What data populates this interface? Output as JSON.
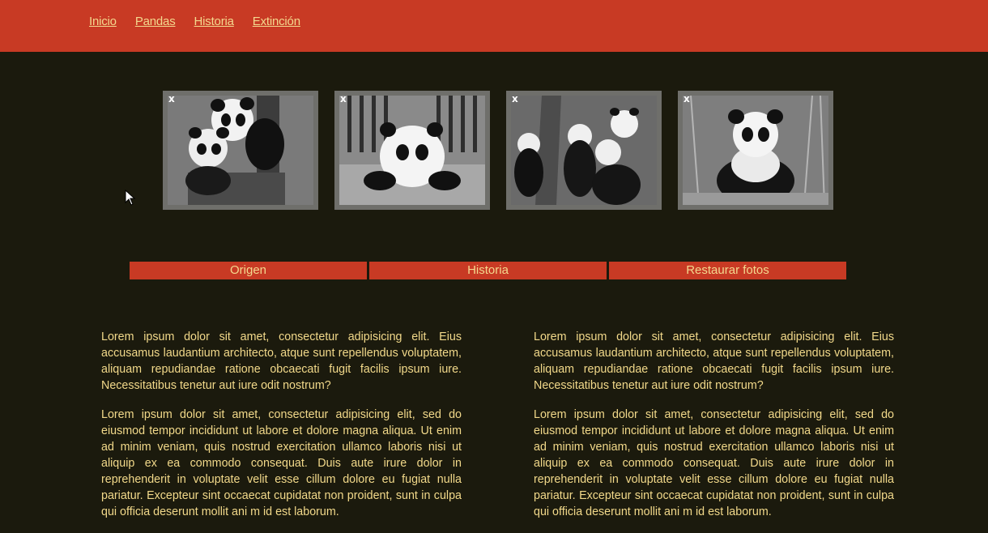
{
  "nav": {
    "items": [
      "Inicio",
      "Pandas",
      "Historia",
      "Extinción"
    ]
  },
  "gallery": {
    "close_label": "x",
    "photos": [
      {
        "icon": "panda-pair-tree-image"
      },
      {
        "icon": "panda-cub-fence-image"
      },
      {
        "icon": "panda-group-tree-image"
      },
      {
        "icon": "panda-bamboo-image"
      }
    ]
  },
  "buttons": {
    "origen": "Origen",
    "historia": "Historia",
    "restaurar": "Restaurar fotos"
  },
  "content": {
    "left": {
      "p1": "Lorem ipsum dolor sit amet, consectetur adipisicing elit. Eius accusamus laudantium architecto, atque sunt repellendus voluptatem, aliquam repudiandae ratione obcaecati fugit facilis ipsum iure. Necessitatibus tenetur aut iure odit nostrum?",
      "p2": "Lorem ipsum dolor sit amet, consectetur adipisicing elit, sed do eiusmod tempor incididunt ut labore et dolore magna aliqua. Ut enim ad minim veniam, quis nostrud exercitation ullamco laboris nisi ut aliquip ex ea commodo consequat. Duis aute irure dolor in reprehenderit in voluptate velit esse cillum dolore eu fugiat nulla pariatur. Excepteur sint occaecat cupidatat non proident, sunt in culpa qui officia deserunt mollit ani m id est laborum."
    },
    "right": {
      "p1": "Lorem ipsum dolor sit amet, consectetur adipisicing elit. Eius accusamus laudantium architecto, atque sunt repellendus voluptatem, aliquam repudiandae ratione obcaecati fugit facilis ipsum iure. Necessitatibus tenetur aut iure odit nostrum?",
      "p2": "Lorem ipsum dolor sit amet, consectetur adipisicing elit, sed do eiusmod tempor incididunt ut labore et dolore magna aliqua. Ut enim ad minim veniam, quis nostrud exercitation ullamco laboris nisi ut aliquip ex ea commodo consequat. Duis aute irure dolor in reprehenderit in voluptate velit esse cillum dolore eu fugiat nulla pariatur. Excepteur sint occaecat cupidatat non proident, sunt in culpa qui officia deserunt mollit ani m id est laborum."
    }
  },
  "colors": {
    "header": "#c83a24",
    "background": "#1b1a0d",
    "text": "#f2d98a",
    "frame": "#6f6f6b"
  }
}
